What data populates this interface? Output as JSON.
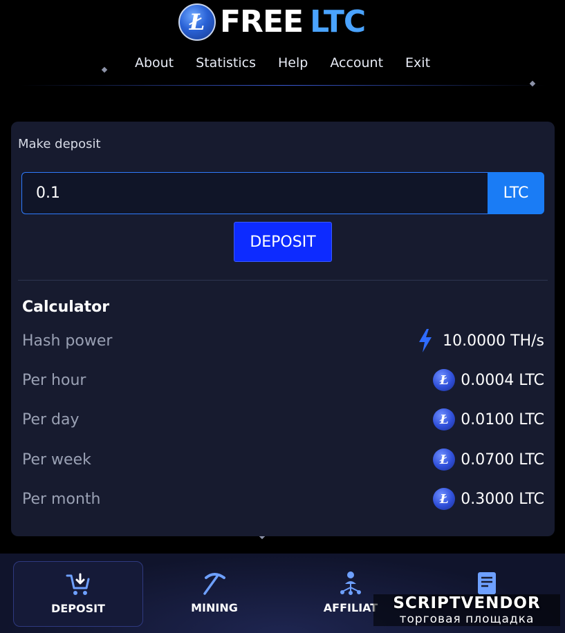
{
  "brand": {
    "logo_letter": "Ł",
    "name_part1": "FREE",
    "name_part2": "LTC"
  },
  "nav": {
    "items": [
      "About",
      "Statistics",
      "Help",
      "Account",
      "Exit"
    ]
  },
  "deposit": {
    "title": "Make deposit",
    "amount_value": "0.1",
    "currency": "LTC",
    "button_label": "DEPOSIT"
  },
  "calculator": {
    "title": "Calculator",
    "hash_power": {
      "label": "Hash power",
      "value": "10.0000 TH/s",
      "icon": "bolt-icon"
    },
    "rows": [
      {
        "label": "Per hour",
        "value": "0.0004 LTC",
        "icon": "litecoin-icon"
      },
      {
        "label": "Per day",
        "value": "0.0100 LTC",
        "icon": "litecoin-icon"
      },
      {
        "label": "Per week",
        "value": "0.0700 LTC",
        "icon": "litecoin-icon"
      },
      {
        "label": "Per month",
        "value": "0.3000 LTC",
        "icon": "litecoin-icon"
      }
    ]
  },
  "bottom_nav": {
    "items": [
      {
        "label": "DEPOSIT",
        "icon": "cart-download-icon",
        "active": true
      },
      {
        "label": "MINING",
        "icon": "pickaxe-icon",
        "active": false
      },
      {
        "label": "AFFILIAT",
        "icon": "network-icon",
        "active": false
      },
      {
        "label": "",
        "icon": "document-icon",
        "active": false
      }
    ]
  },
  "watermark": {
    "title": "SCRIPTVENDOR",
    "subtitle": "торговая площадка"
  },
  "colors": {
    "background": "#000000",
    "card": "#171b2f",
    "accent_blue": "#1a7cf5",
    "button_blue": "#0d2bff",
    "logo_ltc": "#4aa3ff"
  }
}
